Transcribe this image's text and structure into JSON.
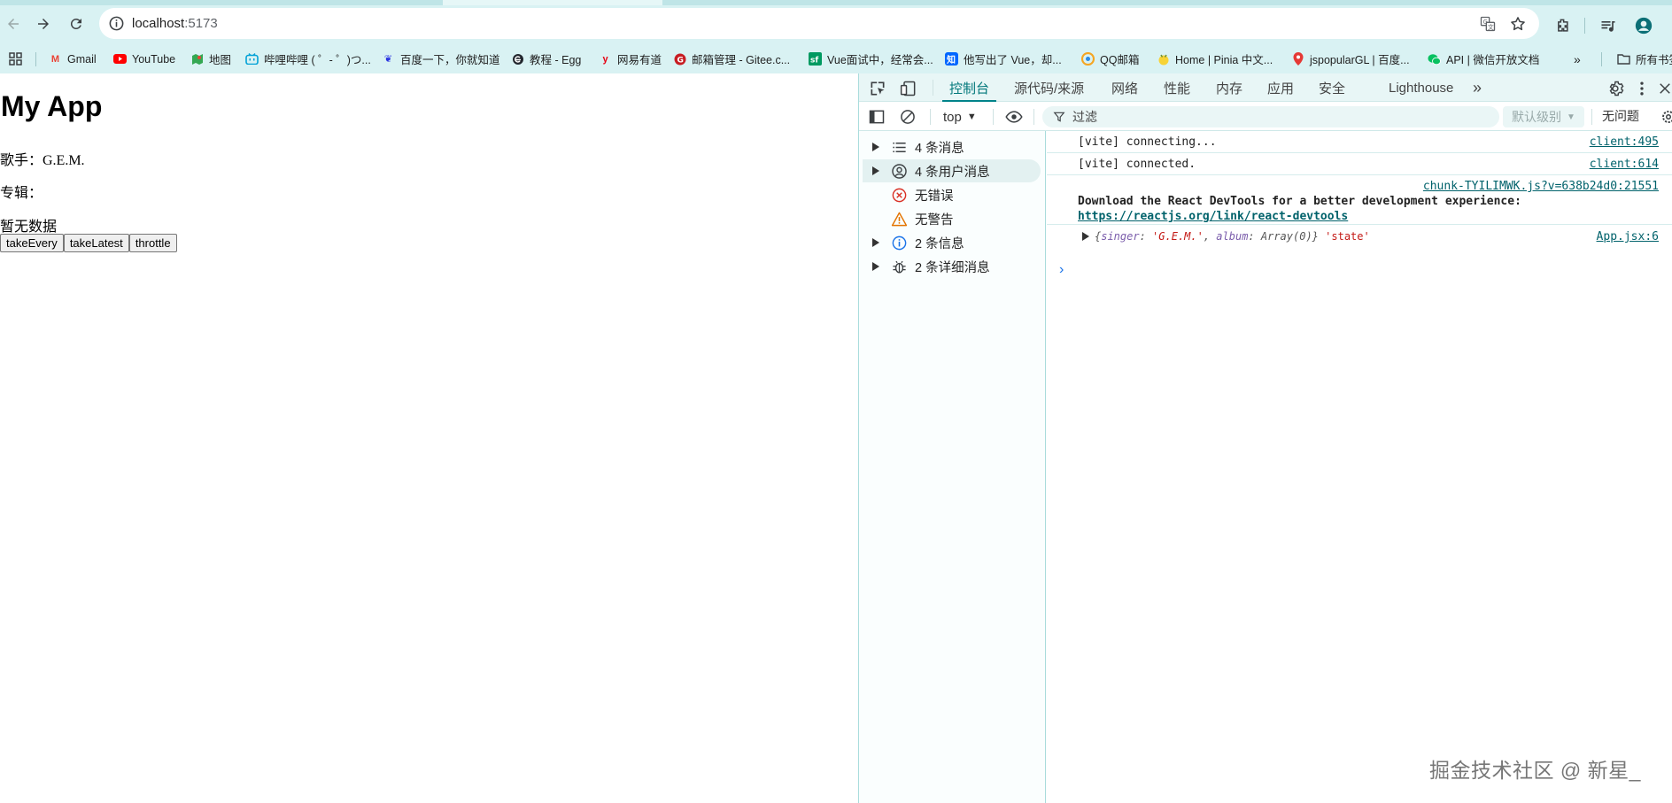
{
  "browser": {
    "url_host": "localhost",
    "url_port": ":5173",
    "bookmarks": [
      {
        "label": "Gmail",
        "icon": "gmail-icon",
        "color": "#ea4335"
      },
      {
        "label": "YouTube",
        "icon": "youtube-icon",
        "color": "#ff0000"
      },
      {
        "label": "地图",
        "icon": "maps-icon",
        "color": "#34a853"
      },
      {
        "label": "哔哩哔哩 ( ゜- ゜)つ...",
        "icon": "bilibili-icon",
        "color": "#00a1d6"
      },
      {
        "label": "百度一下，你就知道",
        "icon": "baidu-icon",
        "color": "#2932e1"
      },
      {
        "label": "教程 - Egg",
        "icon": "egg-icon",
        "color": "#22272e"
      },
      {
        "label": "网易有道",
        "icon": "youdao-icon",
        "color": "#e60012"
      },
      {
        "label": "邮箱管理 - Gitee.c...",
        "icon": "gitee-icon",
        "color": "#c71d23"
      },
      {
        "label": "Vue面试中，经常会...",
        "icon": "segmentfault-icon",
        "color": "#009a61"
      },
      {
        "label": "他写出了 Vue，却...",
        "icon": "zhihu-icon",
        "color": "#0066ff"
      },
      {
        "label": "QQ邮箱",
        "icon": "qqmail-icon",
        "color": "#f5a623"
      },
      {
        "label": "Home | Pinia 中文...",
        "icon": "pinia-icon",
        "color": "#f7d336"
      },
      {
        "label": "jspopularGL | 百度...",
        "icon": "location-pin-icon",
        "color": "#e53935"
      },
      {
        "label": "API | 微信开放文档",
        "icon": "wechat-icon",
        "color": "#07c160"
      }
    ],
    "more_bookmarks": "所有书签"
  },
  "app": {
    "title": "My App",
    "singer_line": "歌手：G.E.M.",
    "album_line": "专辑：",
    "empty_text": "暂无数据",
    "buttons": [
      "takeEvery",
      "takeLatest",
      "throttle"
    ]
  },
  "devtools": {
    "tabs": [
      "控制台",
      "源代码/来源",
      "网络",
      "性能",
      "内存",
      "应用",
      "安全",
      "Lighthouse"
    ],
    "active_tab": "控制台",
    "context": "top",
    "filter_placeholder": "过滤",
    "levels": "默认级别",
    "issues": "无问题",
    "sidebar": [
      {
        "label": "4 条消息",
        "icon": "list-icon",
        "expandable": true
      },
      {
        "label": "4 条用户消息",
        "icon": "user-icon",
        "expandable": true,
        "selected": true
      },
      {
        "label": "无错误",
        "icon": "error-icon",
        "expandable": false
      },
      {
        "label": "无警告",
        "icon": "warning-icon",
        "expandable": false
      },
      {
        "label": "2 条信息",
        "icon": "info-icon",
        "expandable": true
      },
      {
        "label": "2 条详细消息",
        "icon": "bug-icon",
        "expandable": true
      }
    ],
    "console": {
      "line1": "[vite] connecting...",
      "line1_src": "client:495",
      "line2": "[vite] connected.",
      "line2_src": "client:614",
      "line3_src": "chunk-TYILIMWK.js?v=638b24d0:21551",
      "line3_text": "Download the React DevTools for a better development experience:",
      "line3_link": "https://reactjs.org/link/react-devtools",
      "line4_obj_open": "{",
      "line4_k1": "singer",
      "line4_v1": "'G.E.M.'",
      "line4_k2": "album",
      "line4_v2": "Array(0)",
      "line4_obj_close": "}",
      "line4_tail": "'state'",
      "line4_src": "App.jsx:6"
    }
  },
  "watermark": "掘金技术社区 @ 新星_"
}
